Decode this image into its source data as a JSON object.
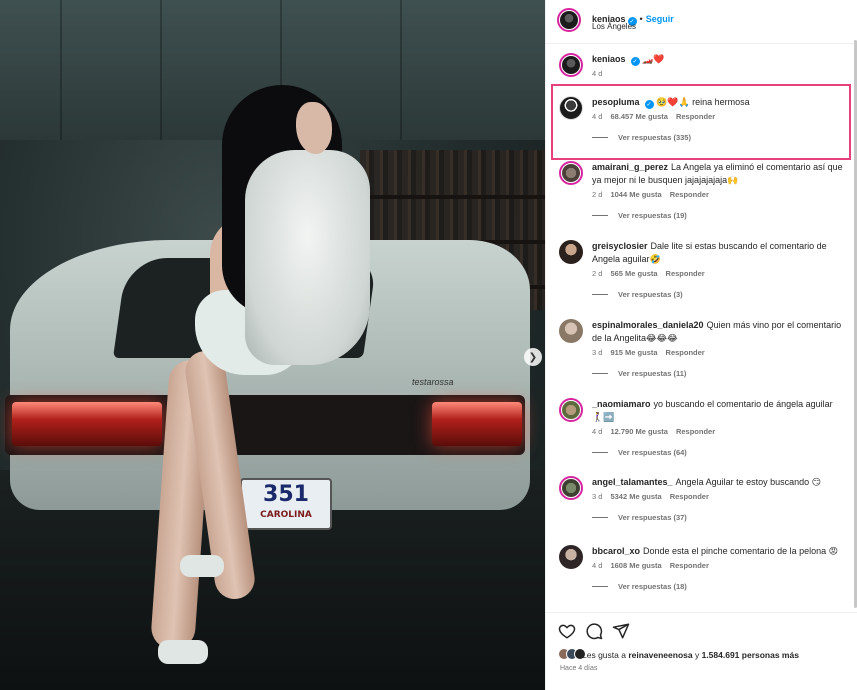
{
  "post": {
    "author": "keniaos",
    "follow_label": "Seguir",
    "location": "Los Ángeles",
    "caption_emoji": "🏎️❤️",
    "caption_time": "4 d",
    "plate_main": "351",
    "plate_sub": "CAROLINA",
    "car_badge": "testarossa"
  },
  "comments": [
    {
      "user": "pesopluma",
      "verified": true,
      "text": "🥹❤️🙏 reina hermosa",
      "time": "4 d",
      "likes": "68.457 Me gusta",
      "reply": "Responder",
      "replies": "Ver respuestas (335)"
    },
    {
      "user": "amairani_g_perez",
      "verified": false,
      "text": "La Angela ya eliminó el comentario así que ya mejor ni le busquen jajajajajaja🙌",
      "time": "2 d",
      "likes": "1044 Me gusta",
      "reply": "Responder",
      "replies": "Ver respuestas (19)"
    },
    {
      "user": "greisyclosier",
      "verified": false,
      "text": "Dale lite si estas buscando el comentario de Angela aguilar🤣",
      "time": "2 d",
      "likes": "565 Me gusta",
      "reply": "Responder",
      "replies": "Ver respuestas (3)"
    },
    {
      "user": "espinalmorales_daniela20",
      "verified": false,
      "text": "Quien más vino por el comentario de la Angelita😂😂😂",
      "time": "3 d",
      "likes": "915 Me gusta",
      "reply": "Responder",
      "replies": "Ver respuestas (11)"
    },
    {
      "user": "_naomiamaro",
      "verified": false,
      "text": "yo buscando el comentario de ángela aguilar 🚶‍♀️➡️",
      "time": "4 d",
      "likes": "12.790 Me gusta",
      "reply": "Responder",
      "replies": "Ver respuestas (64)"
    },
    {
      "user": "angel_talamantes_",
      "verified": false,
      "text": "Angela Aguilar te estoy buscando 😏",
      "time": "3 d",
      "likes": "5342 Me gusta",
      "reply": "Responder",
      "replies": "Ver respuestas (37)"
    },
    {
      "user": "bbcarol_xo",
      "verified": false,
      "text": "Donde esta el pinche comentario de la pelona 😡",
      "time": "4 d",
      "likes": "1608 Me gusta",
      "reply": "Responder",
      "replies": "Ver respuestas (18)"
    }
  ],
  "footer": {
    "likes_prefix": "Les gusta a",
    "likes_user": "reinaveneenosa",
    "likes_and": "y",
    "likes_count": "1.584.691 personas más",
    "time_ago": "Hace 4 días"
  },
  "colors": {
    "highlight": "#e8407a",
    "link": "#0095f6"
  },
  "icons": [
    "heart-icon",
    "comment-icon",
    "share-icon",
    "next-arrow-icon",
    "verified-icon"
  ]
}
